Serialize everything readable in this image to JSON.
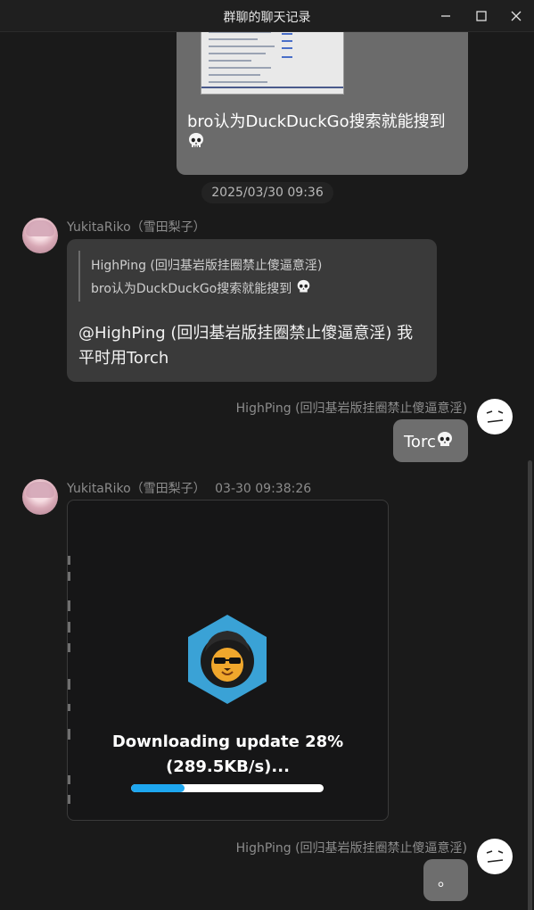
{
  "window": {
    "title": "群聊的聊天记录",
    "controls": [
      "minimize-icon",
      "maximize-icon",
      "close-icon"
    ]
  },
  "messages": {
    "image_message": {
      "caption": "bro认为DuckDuckGo搜索就能搜到"
    },
    "timestamp_divider": "2025/03/30 09:36",
    "reply_message": {
      "sender": "YukitaRiko（雪田梨子）",
      "quote_sender": "HighPing (回归基岩版挂圈禁止傻逼意淫)",
      "quote_text": "bro认为DuckDuckGo搜索就能搜到",
      "text": "@HighPing (回归基岩版挂圈禁止傻逼意淫) 我平时用Torch"
    },
    "torch_message": {
      "sender": "HighPing (回归基岩版挂圈禁止傻逼意淫)",
      "text": "Torc"
    },
    "download_message": {
      "sender": "YukitaRiko（雪田梨子）",
      "time": "03-30 09:38:26",
      "line1": "Downloading update 28%",
      "line2": "(289.5KB/s)...",
      "progress_percent": 28
    },
    "last_message": {
      "sender": "HighPing (回归基岩版挂圈禁止傻逼意淫)",
      "text": "。"
    }
  },
  "icons": {
    "skull": "skull-icon",
    "app_logo": "lion-hexagon-icon"
  },
  "colors": {
    "background": "#1a1a1a",
    "bubble_self": "#6e6e6e",
    "bubble_other": "#3a3a3a",
    "progress_fill": "#1ea7f0",
    "logo_hexagon": "#3aa2d6"
  }
}
